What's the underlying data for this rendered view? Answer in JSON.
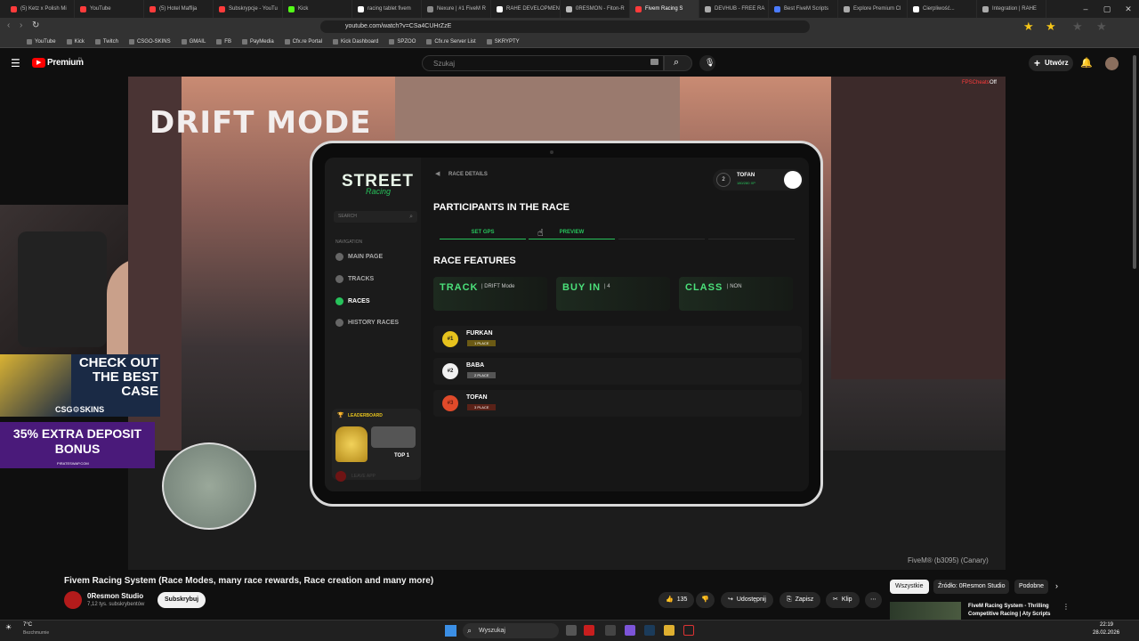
{
  "browser": {
    "tabs": [
      {
        "label": "(5) Ketz x Polish Mi",
        "color": "#ff3b3b"
      },
      {
        "label": "YouTube",
        "color": "#ff3b3b"
      },
      {
        "label": "(5) Hotel Maffija",
        "color": "#ff3b3b"
      },
      {
        "label": "Subskrypcje - YouTu",
        "color": "#ff3b3b"
      },
      {
        "label": "Kick",
        "color": "#53fc18"
      },
      {
        "label": "racing tablet fivem",
        "color": "#ffffff"
      },
      {
        "label": "Nexure | #1 FiveM R",
        "color": "#8a8a8a"
      },
      {
        "label": "RAHE DEVELOPMEN",
        "color": "#ffffff"
      },
      {
        "label": "0RESMON - Fiton-R",
        "color": "#bbbbbb"
      },
      {
        "label": "Fivem Racing S",
        "color": "#ff3b3b",
        "active": true
      },
      {
        "label": "DEVHUB - FREE RA",
        "color": "#aaaaaa"
      },
      {
        "label": "Best FiveM Scripts",
        "color": "#4b7bff"
      },
      {
        "label": "Explore Premium Cl",
        "color": "#aaaaaa"
      },
      {
        "label": "Cierpliwość...",
        "color": "#ffffff"
      },
      {
        "label": "Integration | RAHE",
        "color": "#aaaaaa"
      }
    ],
    "url": "youtube.com/watch?v=CSa4CUHrZzE",
    "bookmarks": [
      "YouTube",
      "Kick",
      "Twitch",
      "CSGO-SKINS",
      "GMAIL",
      "FB",
      "PayMedia",
      "Cfx.re Portal",
      "Kick Dashboard",
      "SPZOO",
      "Cfx.re Server List",
      "SKRYPTY"
    ]
  },
  "youtube": {
    "logo": "Premium",
    "logo_region": "PL",
    "search_placeholder": "Szukaj",
    "create_label": "Utwórz",
    "video_title": "Fivem Racing System (Race Modes, many race rewards, Race creation and many more)",
    "channel": "0Resmon Studio",
    "subscribers": "7,12 tys. subskrybentów",
    "subscribe_label": "Subskrybuj",
    "likes": "135",
    "share_label": "Udostępnij",
    "save_label": "Zapisz",
    "clip_label": "Klip",
    "filter_all": "Wszystkie",
    "filter_source": "Źródło: 0Resmon Studio",
    "filter_similar": "Podobne",
    "rec_title": "FiveM Racing System - Thrilling Competitive Racing | Aty Scripts"
  },
  "video": {
    "overlay_text": "DRIFT MODE",
    "hud_text": "FPSCheats",
    "hud_state": "Off",
    "watermark": "FiveM® (b3095) (Canary)",
    "ad1": "CHECK OUT THE BEST CASE",
    "ad1_brand": "CSG⚙SKINS",
    "ad2": "35% EXTRA DEPOSIT BONUS",
    "ad2_site": "PIRATESWAP.COM"
  },
  "tablet": {
    "logo": "STREET",
    "logo_sub": "Racing",
    "search_placeholder": "SEARCH",
    "nav_label": "NAVIGATION",
    "nav": [
      {
        "label": "MAIN PAGE",
        "active": false
      },
      {
        "label": "TRACKS",
        "active": false
      },
      {
        "label": "RACES",
        "active": true
      },
      {
        "label": "HISTORY RACES",
        "active": false
      }
    ],
    "leaderboard_label": "LEADERBOARD",
    "top_label": "TOP 1",
    "leave_label": "LEAVE APP",
    "breadcrumb": "RACE DETAILS",
    "user_name": "TOFAN",
    "user_level": "2",
    "user_xp": "180/280 XP",
    "participants_title": "PARTICIPANTS IN THE RACE",
    "set_gps": "SET GPS",
    "preview": "PREVIEW",
    "features_title": "RACE FEATURES",
    "features": [
      {
        "name": "TRACK",
        "value": "| DRIFT Mode"
      },
      {
        "name": "BUY IN",
        "value": "| 4"
      },
      {
        "name": "CLASS",
        "value": "| NON"
      }
    ],
    "participants": [
      {
        "rank": "#1",
        "name": "FURKAN",
        "place": "1 PLACE",
        "color": "#e6c21d",
        "place_bg": "#6b5a14"
      },
      {
        "rank": "#2",
        "name": "BABA",
        "place": "2 PLACE",
        "color": "#f2f2f2",
        "place_bg": "#555555"
      },
      {
        "rank": "#3",
        "name": "TOFAN",
        "place": "3 PLACE",
        "color": "#e04a2a",
        "place_bg": "#5a2218"
      }
    ]
  },
  "taskbar": {
    "weather": "7°C",
    "weather_desc": "Bezchmurnie",
    "search": "Wyszukaj",
    "time": "22:19",
    "date": "28.02.2026"
  }
}
